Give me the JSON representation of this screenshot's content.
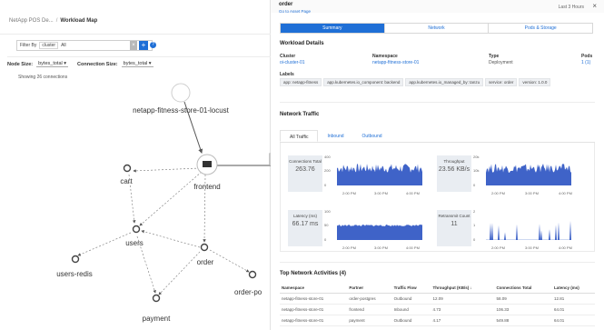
{
  "breadcrumb": {
    "parent": "NetApp POS De...",
    "current": "Workload Map"
  },
  "filter": {
    "label": "Filter By",
    "field": "cluster",
    "value": "All",
    "clear": "×",
    "add": "+",
    "help": "?"
  },
  "size_controls": {
    "node_size_label": "Node Size:",
    "node_size_value": "bytes_total",
    "connection_size_label": "Connection Size:",
    "connection_size_value": "bytes_total"
  },
  "map": {
    "showing": "Showing 26 connections",
    "nodes": {
      "locust": "netapp-fitness-store-01-locust",
      "frontend": "frontend",
      "cart": "cart",
      "users": "users",
      "users_redis": "users-redis",
      "order": "order",
      "order_po": "order-po",
      "payment": "payment"
    }
  },
  "panel": {
    "title": "order",
    "subtitle": "Go to Asset Page",
    "time": "Last 3 Hours",
    "close": "×",
    "tabs": [
      "Summary",
      "Network",
      "Pods & Storage"
    ],
    "active_tab": "Summary",
    "details_title": "Workload Details",
    "fields": [
      {
        "key": "Cluster",
        "value": "oi-cluster-01"
      },
      {
        "key": "Namespace",
        "value": "netapp-fitness-store-01"
      },
      {
        "key": "Type",
        "value": "Deployment"
      },
      {
        "key": "Pods",
        "value": "1 (1)"
      }
    ],
    "labels_title": "Labels",
    "labels": [
      "app: netapp-fitness",
      "app.kubernetes.io_component: backend",
      "app.kubernetes.io_managed_by: tanzu",
      "service: order",
      "version: 1.0.0"
    ],
    "network_title": "Network Traffic",
    "network_tabs": [
      "All Traffic",
      "Inbound",
      "Outbound"
    ],
    "stats": {
      "connections_label": "Connections Total",
      "connections_value": "263.76",
      "throughput_label": "Throughput",
      "throughput_value": "23.56 KB/s",
      "latency_label": "Latency (ms)",
      "latency_value": "66.17 ms",
      "retransmit_label": "Retransmit Count",
      "retransmit_value": "11"
    },
    "top_title": "Top Network Activities (4)",
    "table": {
      "columns": [
        "Namespace",
        "Partner",
        "Traffic Flow",
        "Throughput (KB/s) ↓",
        "Connections Total",
        "Latency (ms)"
      ],
      "rows": [
        [
          "netapp-fitness-store-01",
          "order-postgres",
          "Outbound",
          "12.09",
          "58.09",
          "12.81"
        ],
        [
          "netapp-fitness-store-01",
          "frontend",
          "Inbound",
          "4.73",
          "106.33",
          "64.01"
        ],
        [
          "netapp-fitness-store-01",
          "payment",
          "Outbound",
          "4.17",
          "549.88",
          "64.01"
        ]
      ]
    }
  },
  "charts": {
    "connections": {
      "y_ticks": [
        "400",
        "200",
        "0"
      ],
      "x_ticks": [
        "2:00 PM",
        "3:00 PM",
        "4:00 PM"
      ]
    },
    "throughput": {
      "y_ticks": [
        "20k",
        "10k",
        "0"
      ],
      "x_ticks": [
        "2:00 PM",
        "3:00 PM",
        "4:00 PM"
      ]
    },
    "latency": {
      "y_ticks": [
        "100",
        "50",
        "0"
      ],
      "x_ticks": [
        "2:00 PM",
        "3:00 PM",
        "4:00 PM"
      ]
    },
    "retransmit": {
      "y_ticks": [
        "2",
        "1",
        "0"
      ],
      "x_ticks": [
        "2:00 PM",
        "3:00 PM",
        "4:00 PM"
      ]
    }
  },
  "colors": {
    "accent": "#1f6fd6",
    "chart_fill": "#3f63c8"
  }
}
